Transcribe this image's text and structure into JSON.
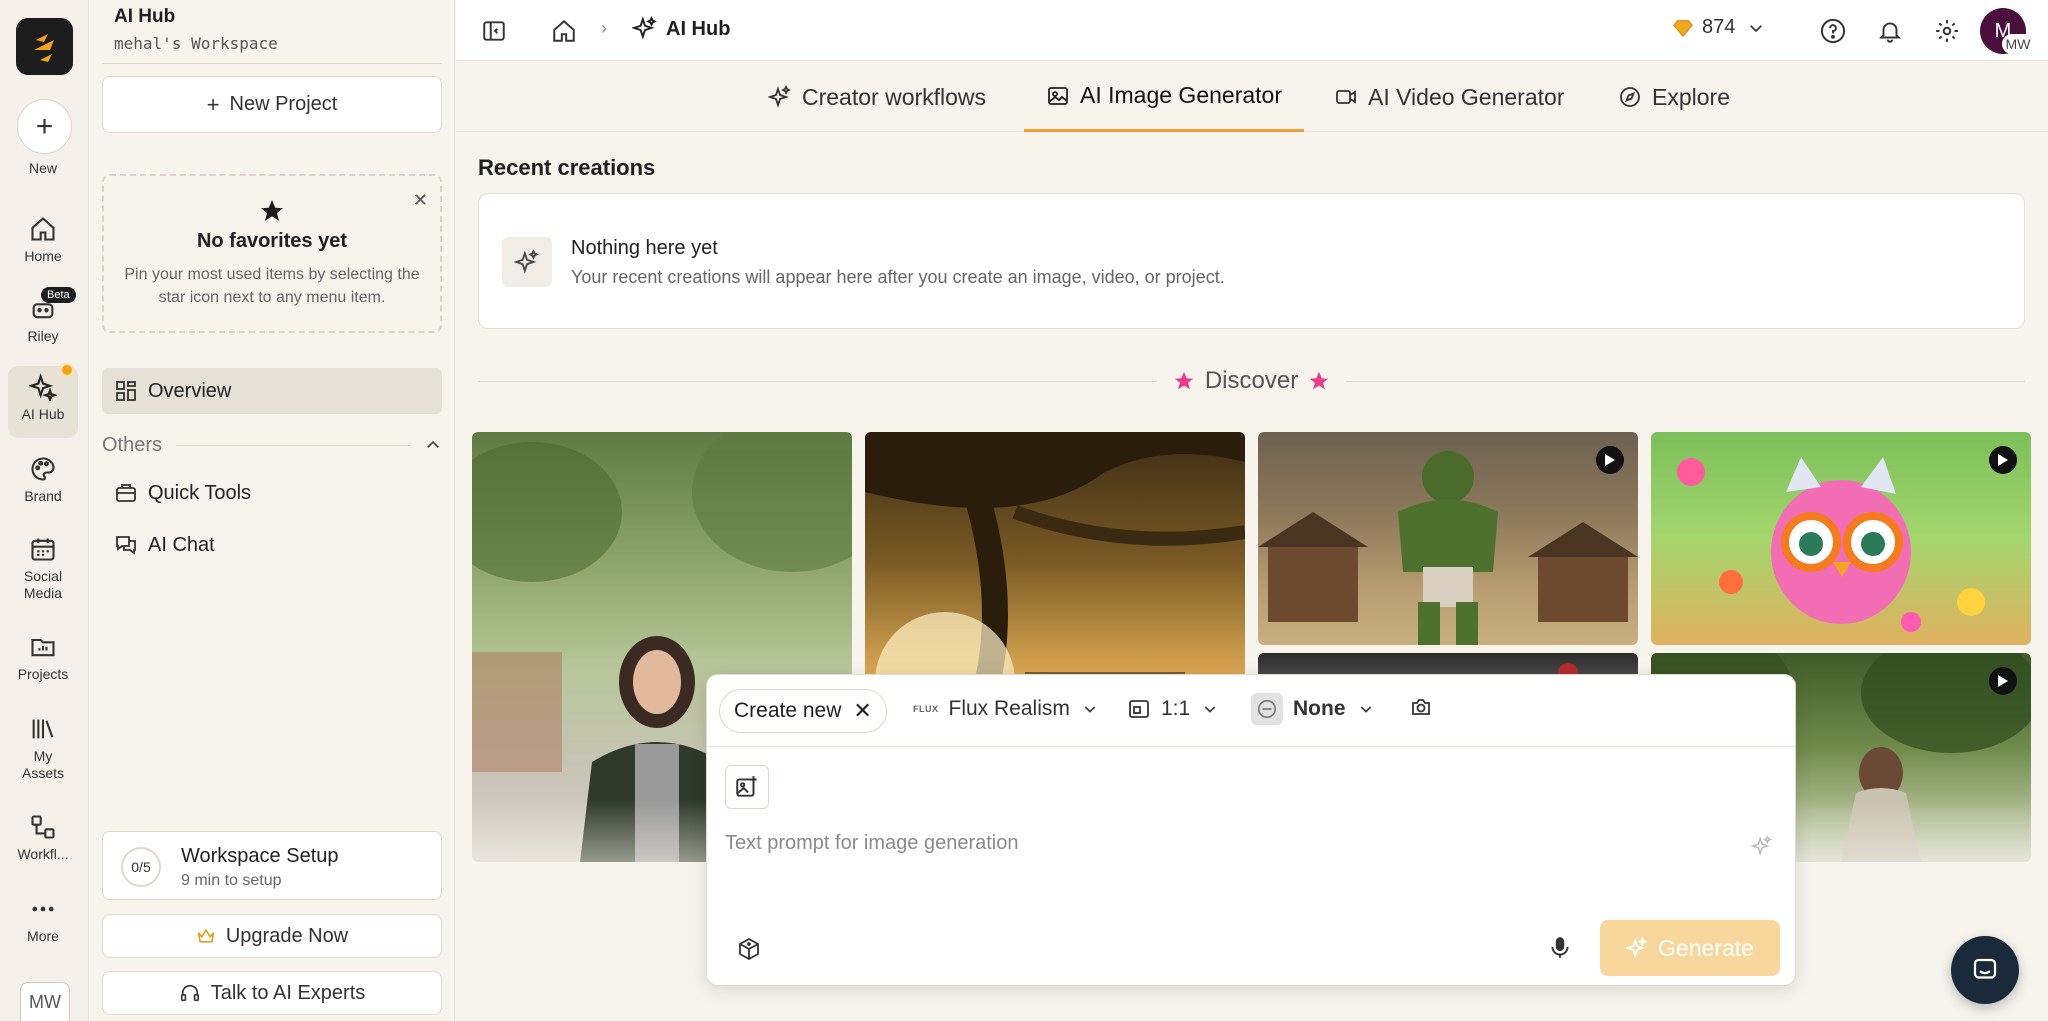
{
  "rail": {
    "new_label": "New",
    "items": [
      {
        "label": "Home",
        "icon": "home-icon"
      },
      {
        "label": "Riley",
        "icon": "riley-icon"
      },
      {
        "label": "AI Hub",
        "icon": "sparkles-icon"
      },
      {
        "label": "Brand",
        "icon": "palette-icon"
      },
      {
        "label": "Social Media",
        "icon": "calendar-icon"
      },
      {
        "label": "Projects",
        "icon": "folder-icon"
      },
      {
        "label": "My Assets",
        "icon": "library-icon"
      },
      {
        "label": "Workfl...",
        "icon": "workflow-icon"
      },
      {
        "label": "More",
        "icon": "more-icon"
      }
    ],
    "beta_badge": "Beta",
    "avatar_initials": "MW",
    "accent": "#f4a520"
  },
  "panel": {
    "workspace_title": "AI Hub",
    "workspace_sub": "mehal's Workspace",
    "new_project": "New Project",
    "fav_title": "No favorites yet",
    "fav_desc": "Pin your most used items by selecting the star icon next to any menu item.",
    "overview": "Overview",
    "others": "Others",
    "quick_tools": "Quick Tools",
    "ai_chat": "AI Chat",
    "setup_progress": "0/5",
    "setup_title": "Workspace Setup",
    "setup_sub": "9 min to setup",
    "upgrade": "Upgrade Now",
    "talk_experts": "Talk to AI Experts"
  },
  "topbar": {
    "crumb": "AI Hub",
    "credits": "874",
    "avatar_letter": "M",
    "avatar_initials": "MW"
  },
  "tabs": [
    {
      "label": "Creator workflows",
      "icon": "sparkles-icon"
    },
    {
      "label": "AI Image Generator",
      "icon": "image-icon",
      "active": true
    },
    {
      "label": "AI Video Generator",
      "icon": "video-icon"
    },
    {
      "label": "Explore",
      "icon": "compass-icon"
    }
  ],
  "recent": {
    "title": "Recent creations",
    "empty_head": "Nothing here yet",
    "empty_sub": "Your recent creations will appear here after you create an image, video, or project."
  },
  "discover": {
    "label": "Discover",
    "star_color": "#e83e8c"
  },
  "composer": {
    "create_new": "Create new",
    "model_tag": "FLUX",
    "model": "Flux Realism",
    "ratio": "1:1",
    "style": "None",
    "prompt_placeholder": "Text prompt for image generation",
    "generate": "Generate",
    "generate_color": "#f8d79c"
  }
}
